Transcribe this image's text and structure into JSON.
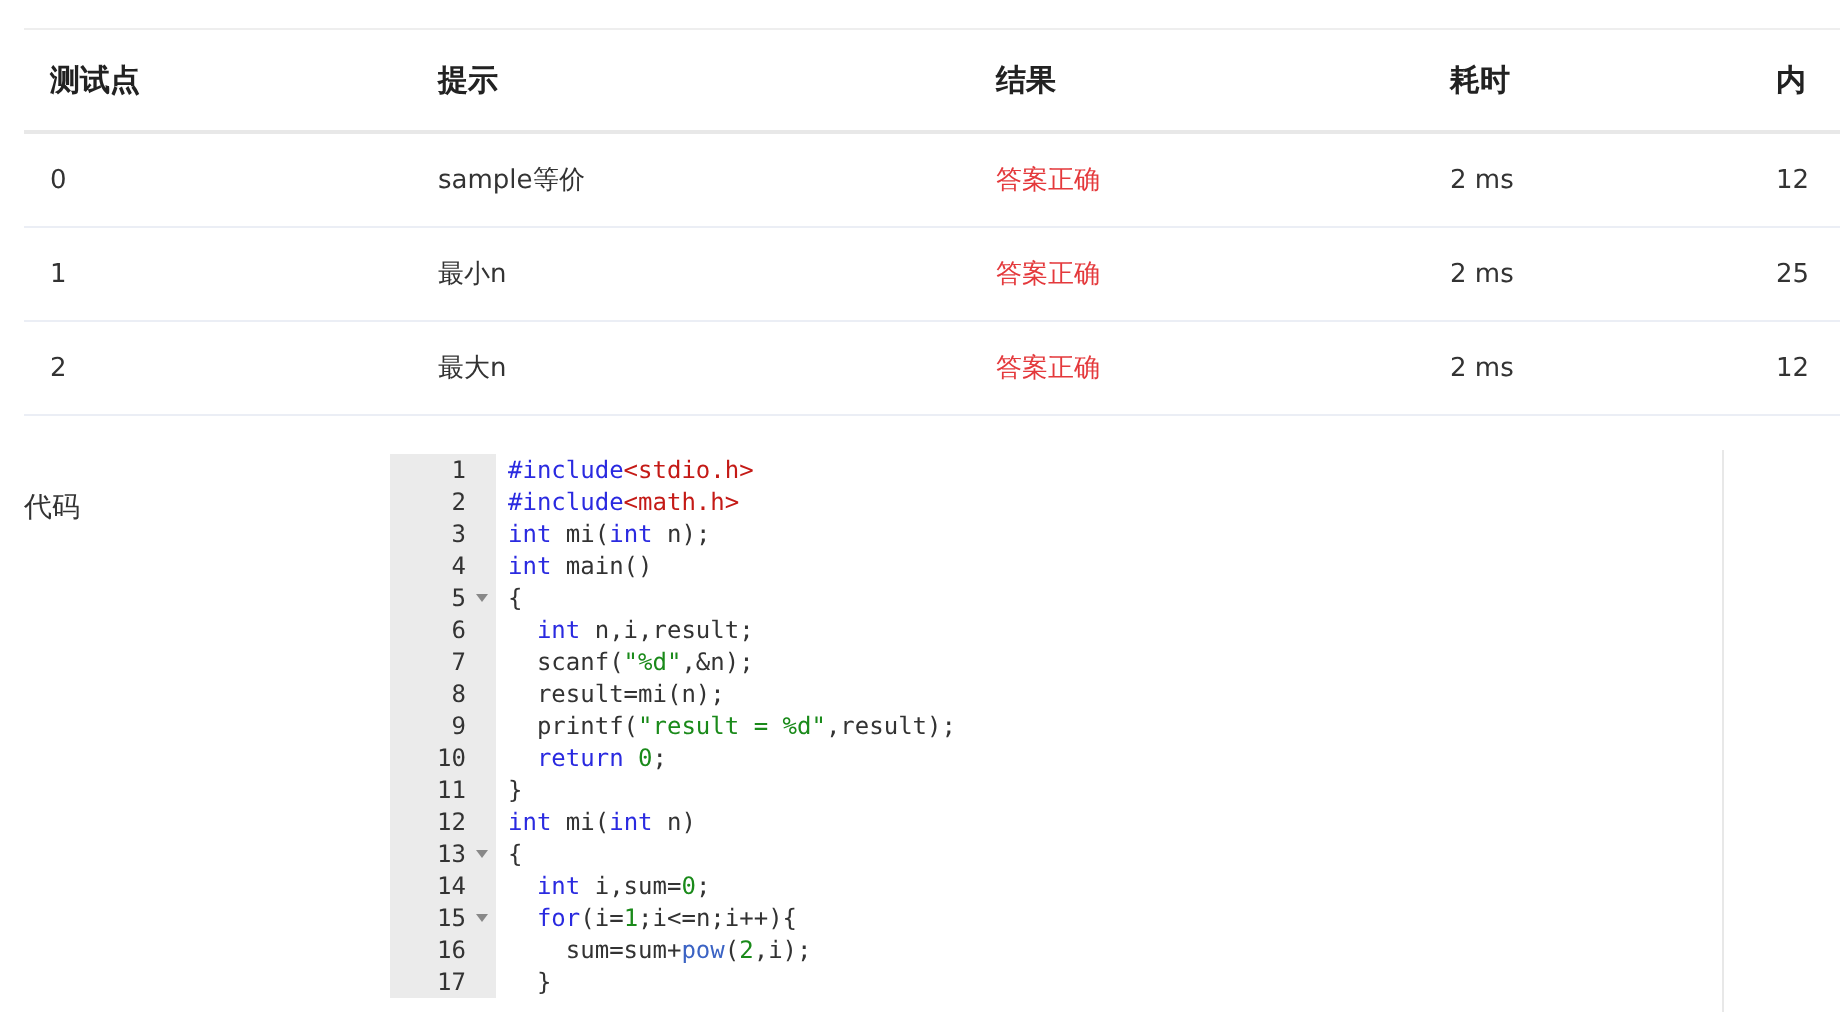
{
  "table": {
    "columns": [
      "测试点",
      "提示",
      "结果",
      "耗时",
      "内"
    ],
    "rows": [
      {
        "cells": [
          "0",
          "sample等价",
          "答案正确",
          "2 ms",
          "12"
        ]
      },
      {
        "cells": [
          "1",
          "最小n",
          "答案正确",
          "2 ms",
          "25"
        ]
      },
      {
        "cells": [
          "2",
          "最大n",
          "答案正确",
          "2 ms",
          "12"
        ]
      }
    ]
  },
  "code_section": {
    "label": "代码",
    "lines": [
      {
        "number": "1",
        "foldable": false,
        "tokens": [
          {
            "kind": "meta",
            "text": "#include"
          },
          {
            "kind": "header",
            "text": "<stdio.h>"
          }
        ]
      },
      {
        "number": "2",
        "foldable": false,
        "tokens": [
          {
            "kind": "meta",
            "text": "#include"
          },
          {
            "kind": "header",
            "text": "<math.h>"
          }
        ]
      },
      {
        "number": "3",
        "foldable": false,
        "tokens": [
          {
            "kind": "keyword",
            "text": "int"
          },
          {
            "kind": "plain",
            "text": " mi("
          },
          {
            "kind": "keyword",
            "text": "int"
          },
          {
            "kind": "plain",
            "text": " n);"
          }
        ]
      },
      {
        "number": "4",
        "foldable": false,
        "tokens": [
          {
            "kind": "keyword",
            "text": "int"
          },
          {
            "kind": "plain",
            "text": " main()"
          }
        ]
      },
      {
        "number": "5",
        "foldable": true,
        "tokens": [
          {
            "kind": "plain",
            "text": "{"
          }
        ]
      },
      {
        "number": "6",
        "foldable": false,
        "tokens": [
          {
            "kind": "keyword",
            "text": "  int"
          },
          {
            "kind": "plain",
            "text": " n,i,result;"
          }
        ]
      },
      {
        "number": "7",
        "foldable": false,
        "tokens": [
          {
            "kind": "plain",
            "text": "  scanf("
          },
          {
            "kind": "string",
            "text": "\"%d\""
          },
          {
            "kind": "plain",
            "text": ",&n);"
          }
        ]
      },
      {
        "number": "8",
        "foldable": false,
        "tokens": [
          {
            "kind": "plain",
            "text": "  result=mi(n);"
          }
        ]
      },
      {
        "number": "9",
        "foldable": false,
        "tokens": [
          {
            "kind": "plain",
            "text": "  printf("
          },
          {
            "kind": "string",
            "text": "\"result = %d\""
          },
          {
            "kind": "plain",
            "text": ",result);"
          }
        ]
      },
      {
        "number": "10",
        "foldable": false,
        "tokens": [
          {
            "kind": "keyword",
            "text": "  return"
          },
          {
            "kind": "number",
            "text": " 0"
          },
          {
            "kind": "plain",
            "text": ";"
          }
        ]
      },
      {
        "number": "11",
        "foldable": false,
        "tokens": [
          {
            "kind": "plain",
            "text": "}"
          }
        ]
      },
      {
        "number": "12",
        "foldable": false,
        "tokens": [
          {
            "kind": "keyword",
            "text": "int"
          },
          {
            "kind": "plain",
            "text": " mi("
          },
          {
            "kind": "keyword",
            "text": "int"
          },
          {
            "kind": "plain",
            "text": " n)"
          }
        ]
      },
      {
        "number": "13",
        "foldable": true,
        "tokens": [
          {
            "kind": "plain",
            "text": "{"
          }
        ]
      },
      {
        "number": "14",
        "foldable": false,
        "tokens": [
          {
            "kind": "keyword",
            "text": "  int"
          },
          {
            "kind": "plain",
            "text": " i,sum="
          },
          {
            "kind": "number",
            "text": "0"
          },
          {
            "kind": "plain",
            "text": ";"
          }
        ]
      },
      {
        "number": "15",
        "foldable": true,
        "tokens": [
          {
            "kind": "keyword",
            "text": "  for"
          },
          {
            "kind": "plain",
            "text": "(i="
          },
          {
            "kind": "number",
            "text": "1"
          },
          {
            "kind": "plain",
            "text": ";i<=n;i++){"
          }
        ]
      },
      {
        "number": "16",
        "foldable": false,
        "tokens": [
          {
            "kind": "plain",
            "text": "    sum=sum+"
          },
          {
            "kind": "builtin",
            "text": "pow"
          },
          {
            "kind": "plain",
            "text": "("
          },
          {
            "kind": "number",
            "text": "2"
          },
          {
            "kind": "plain",
            "text": ",i);"
          }
        ]
      },
      {
        "number": "17",
        "foldable": false,
        "tokens": [
          {
            "kind": "plain",
            "text": "  }"
          }
        ]
      }
    ]
  }
}
